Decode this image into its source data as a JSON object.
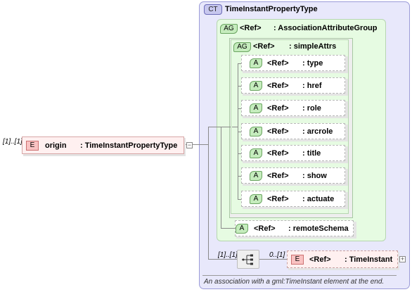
{
  "complex_type": {
    "badge": "CT",
    "name": "TimeInstantPropertyType",
    "documentation": "An association with a gml:TimeInstant element at the end."
  },
  "root_element": {
    "occurrence": "[1]..[1]",
    "badge": "E",
    "name": "origin",
    "type": ": TimeInstantPropertyType",
    "expand": "−"
  },
  "attribute_group_outer": {
    "badge": "AG",
    "ref": "<Ref>",
    "name": ": AssociationAttributeGroup"
  },
  "attribute_group_inner": {
    "badge": "AG",
    "ref": "<Ref>",
    "name": ": simpleAttrs"
  },
  "attributes": [
    {
      "badge": "A",
      "ref": "<Ref>",
      "name": ": type"
    },
    {
      "badge": "A",
      "ref": "<Ref>",
      "name": ": href"
    },
    {
      "badge": "A",
      "ref": "<Ref>",
      "name": ": role"
    },
    {
      "badge": "A",
      "ref": "<Ref>",
      "name": ": arcrole"
    },
    {
      "badge": "A",
      "ref": "<Ref>",
      "name": ": title"
    },
    {
      "badge": "A",
      "ref": "<Ref>",
      "name": ": show"
    },
    {
      "badge": "A",
      "ref": "<Ref>",
      "name": ": actuate"
    }
  ],
  "remote_schema": {
    "badge": "A",
    "ref": "<Ref>",
    "name": ": remoteSchema"
  },
  "sequence": {
    "occurrence": "[1]..[1]"
  },
  "child_element": {
    "occurrence": "0..[1]",
    "badge": "E",
    "ref": "<Ref>",
    "name": ": TimeInstant",
    "expand": "+"
  }
}
